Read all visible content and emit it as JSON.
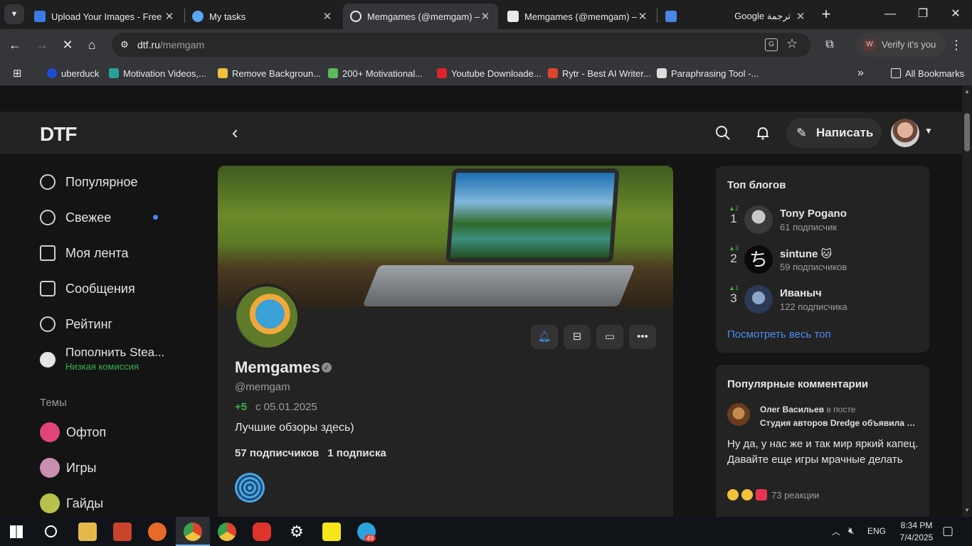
{
  "browser": {
    "tabs": [
      {
        "title": "Upload Your Images - Free I",
        "favicon_color": "#3b7be8"
      },
      {
        "title": "My tasks",
        "favicon_color": "#5aa7f5"
      },
      {
        "title": "Memgames (@memgam) —",
        "favicon_color": "#e8eaed"
      },
      {
        "title": "Memgames (@memgam) —",
        "favicon_color": "#e8eaed"
      },
      {
        "title": "Google ترجمة",
        "favicon_color": "#4a86e8"
      }
    ],
    "url_domain": "dtf.ru",
    "url_path": "/memgam",
    "verify_label": "Verify it's you",
    "verify_badge": "W",
    "bookmarks": [
      {
        "label": "uberduck",
        "color": "#1d4ed8"
      },
      {
        "label": "Motivation Videos,...",
        "color": "#2aa198"
      },
      {
        "label": "Remove Backgroun...",
        "color": "#f0c040"
      },
      {
        "label": "200+ Motivational...",
        "color": "#5cb85c"
      },
      {
        "label": "Youtube Downloade...",
        "color": "#e0242a"
      },
      {
        "label": "Rytr - Best AI Writer...",
        "color": "#e0442a"
      },
      {
        "label": "Paraphrasing Tool -...",
        "color": "#dddddd"
      }
    ],
    "all_bookmarks": "All Bookmarks"
  },
  "site": {
    "logo": "DTF",
    "write_label": "Написать",
    "nav": [
      {
        "label": "Популярное",
        "icon": "fire-icon"
      },
      {
        "label": "Свежее",
        "icon": "clock-icon"
      },
      {
        "label": "Моя лента",
        "icon": "feed-icon"
      },
      {
        "label": "Сообщения",
        "icon": "message-icon"
      },
      {
        "label": "Рейтинг",
        "icon": "compass-icon"
      }
    ],
    "steam": {
      "label": "Пополнить Stea...",
      "sub": "Низкая комиссия",
      "sub_color": "#37b24d"
    },
    "topics_title": "Темы",
    "topics": [
      {
        "label": "Офтоп",
        "color": "#e0447a"
      },
      {
        "label": "Игры",
        "color": "#c98fb0"
      },
      {
        "label": "Гайды",
        "color": "#b8c24a"
      }
    ]
  },
  "profile": {
    "name": "Memgames",
    "handle": "@memgam",
    "rating": "+5",
    "since": "с 05.01.2025",
    "description": "Лучшие обзоры здесь)",
    "subscribers": "57 подписчиков",
    "subscriptions": "1 подписка"
  },
  "top_blogs": {
    "title": "Топ блогов",
    "items": [
      {
        "rank": "1",
        "delta": "▲2",
        "name": "Tony Pogano",
        "subs": "61 подписчик"
      },
      {
        "rank": "2",
        "delta": "▲3",
        "name": "sintune 🐱",
        "subs": "59 подписчиков"
      },
      {
        "rank": "3",
        "delta": "▲1",
        "name": "Иваныч",
        "subs": "122 подписчика"
      }
    ],
    "see_all": "Посмотреть весь топ"
  },
  "popular_comments": {
    "title": "Популярные комментарии",
    "author": "Олег Васильев",
    "in_post": "в посте",
    "post": "Студия авторов Dredge объявила о ...",
    "text": "Ну да, у нас же и так мир яркий капец. Давайте еще игры мрачные делать",
    "reactions": "73 реакции"
  },
  "taskbar": {
    "lang": "ENG",
    "time": "8:34 PM",
    "date": "7/4/2025",
    "telegram_badge": "49"
  },
  "colors": {
    "accent": "#4c8cf0",
    "positive": "#37b24d",
    "background": "#141414",
    "card": "#232323"
  }
}
